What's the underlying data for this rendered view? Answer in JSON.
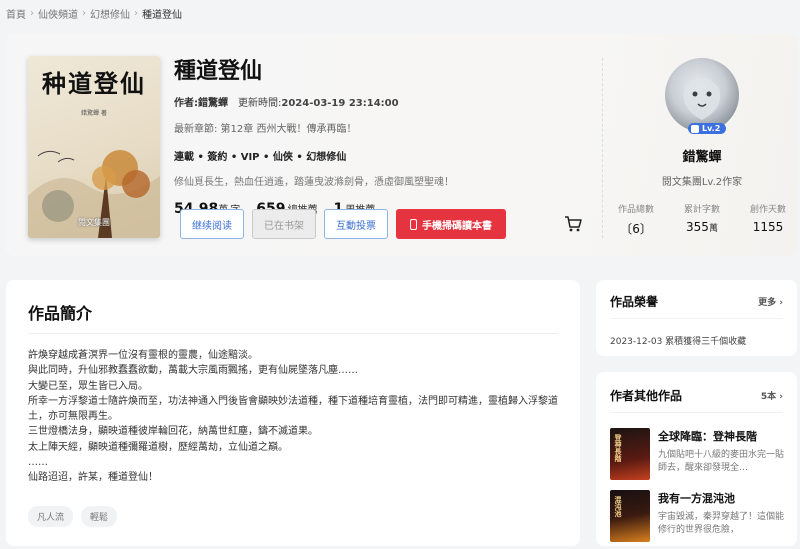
{
  "breadcrumb": {
    "home": "首頁",
    "channel": "仙俠頻道",
    "genre": "幻想修仙",
    "current": "種道登仙"
  },
  "book": {
    "cover_title": "种道登仙",
    "cover_author": "錯驚蟬 著",
    "cover_publisher": "閱文集團",
    "title": "種道登仙",
    "author_label": "作者:錯驚蟬",
    "updated_label": "更新時間:",
    "updated_time": "2024-03-19 23:14:00",
    "latest_chapter": "最新章節: 第12章 西州大戰！傳承再臨！",
    "tags": "連載 • 簽約 • VIP • 仙俠 • 幻想修仙",
    "tagline": "修仙覓長生，熱血任逍遙，踏蓮曳波滌劍骨，憑虛御風塑聖魂！",
    "stats": [
      {
        "num": "54.98",
        "unit": "萬",
        "label": "字"
      },
      {
        "num": "659",
        "unit": "",
        "label": "總推薦"
      },
      {
        "num": "1",
        "unit": "",
        "label": "周推薦"
      }
    ],
    "buttons": {
      "read": "继续阅读",
      "shelf": "已在书架",
      "vote": "互動投票",
      "mobile": "手機掃碼讀本書"
    }
  },
  "author": {
    "level": "Lv.2",
    "name": "錯驚蟬",
    "title": "閱文集團Lv.2作家",
    "stats": [
      {
        "label": "作品總數",
        "value": "6",
        "unit": ""
      },
      {
        "label": "累計字數",
        "value": "355",
        "unit": "萬"
      },
      {
        "label": "創作天數",
        "value": "1155",
        "unit": ""
      }
    ]
  },
  "intro": {
    "heading": "作品簡介",
    "lines": [
      "許煥穿越成蒼溟界一位沒有靈根的靈農，仙途黯淡。",
      "與此同時，升仙邪教蠢蠢欲動，萬載大宗風雨飄搖，更有仙屍墜落凡塵……",
      "大變已至，眾生皆已入局。",
      "所幸一方浮黎道士隨許煥而至，功法神通入門後皆會顯映妙法道種，種下道種培育靈植，法門即可精進，靈植歸入浮黎道土，亦可無限再生。",
      "三世燈橋法身，顯映道種彼岸輪回花，納萬世紅塵，鑄不滅道果。",
      "太上陣天經，顯映道種彌羅道樹，歷經萬劫，立仙道之巔。",
      "……",
      "仙路迢迢，許某，種道登仙！"
    ],
    "keywords": [
      "凡人流",
      "輕鬆"
    ]
  },
  "honor": {
    "heading": "作品榮譽",
    "more": "更多",
    "items": [
      "2023-12-03 累積獲得三千個收藏"
    ]
  },
  "other_works": {
    "heading": "作者其他作品",
    "more": "5本",
    "books": [
      {
        "title": "全球降臨：登神長階",
        "desc": "九個貼吧十八級的麥田水完一貼師去，醒來卻發現全…",
        "cover_text": "登神長階"
      },
      {
        "title": "我有一方混沌池",
        "desc": "宇宙毀滅，秦羿穿越了！這個能修行的世界很危險，",
        "cover_text": "混沌池"
      }
    ]
  },
  "colors": {
    "accent_blue": "#3a6fd1",
    "accent_red": "#e5343f"
  }
}
